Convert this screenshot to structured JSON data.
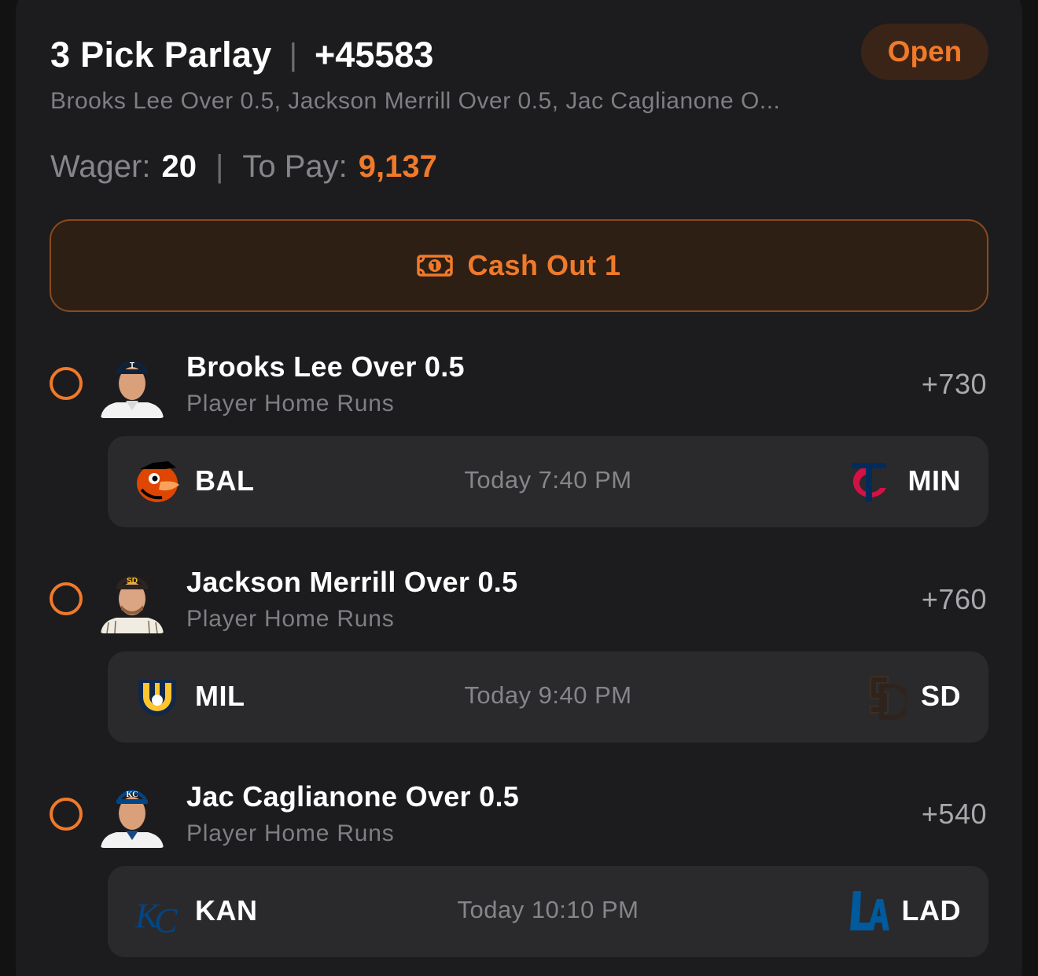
{
  "bet": {
    "title": "3 Pick Parlay",
    "separator": "|",
    "odds": "+45583",
    "status": "Open",
    "summary": "Brooks Lee Over 0.5, Jackson Merrill Over 0.5, Jac Caglianone O...",
    "wager_label": "Wager:",
    "wager_value": "20",
    "pay_label": "To Pay:",
    "pay_value": "9,137",
    "cashout_label": "Cash Out 1",
    "accent_color": "#f07a2a"
  },
  "legs": [
    {
      "pick": "Brooks Lee Over 0.5",
      "market": "Player Home Runs",
      "odds": "+730",
      "avatar_icon": "player-headshot-twins",
      "game": {
        "away": {
          "abbr": "BAL",
          "icon": "orioles-logo-icon"
        },
        "home": {
          "abbr": "MIN",
          "icon": "twins-logo-icon"
        },
        "time": "Today 7:40 PM"
      }
    },
    {
      "pick": "Jackson Merrill Over 0.5",
      "market": "Player Home Runs",
      "odds": "+760",
      "avatar_icon": "player-headshot-padres",
      "game": {
        "away": {
          "abbr": "MIL",
          "icon": "brewers-logo-icon"
        },
        "home": {
          "abbr": "SD",
          "icon": "padres-logo-icon"
        },
        "time": "Today 9:40 PM"
      }
    },
    {
      "pick": "Jac Caglianone Over 0.5",
      "market": "Player Home Runs",
      "odds": "+540",
      "avatar_icon": "player-headshot-royals",
      "game": {
        "away": {
          "abbr": "KAN",
          "icon": "royals-logo-icon"
        },
        "home": {
          "abbr": "LAD",
          "icon": "dodgers-logo-icon"
        },
        "time": "Today 10:10 PM"
      }
    }
  ]
}
